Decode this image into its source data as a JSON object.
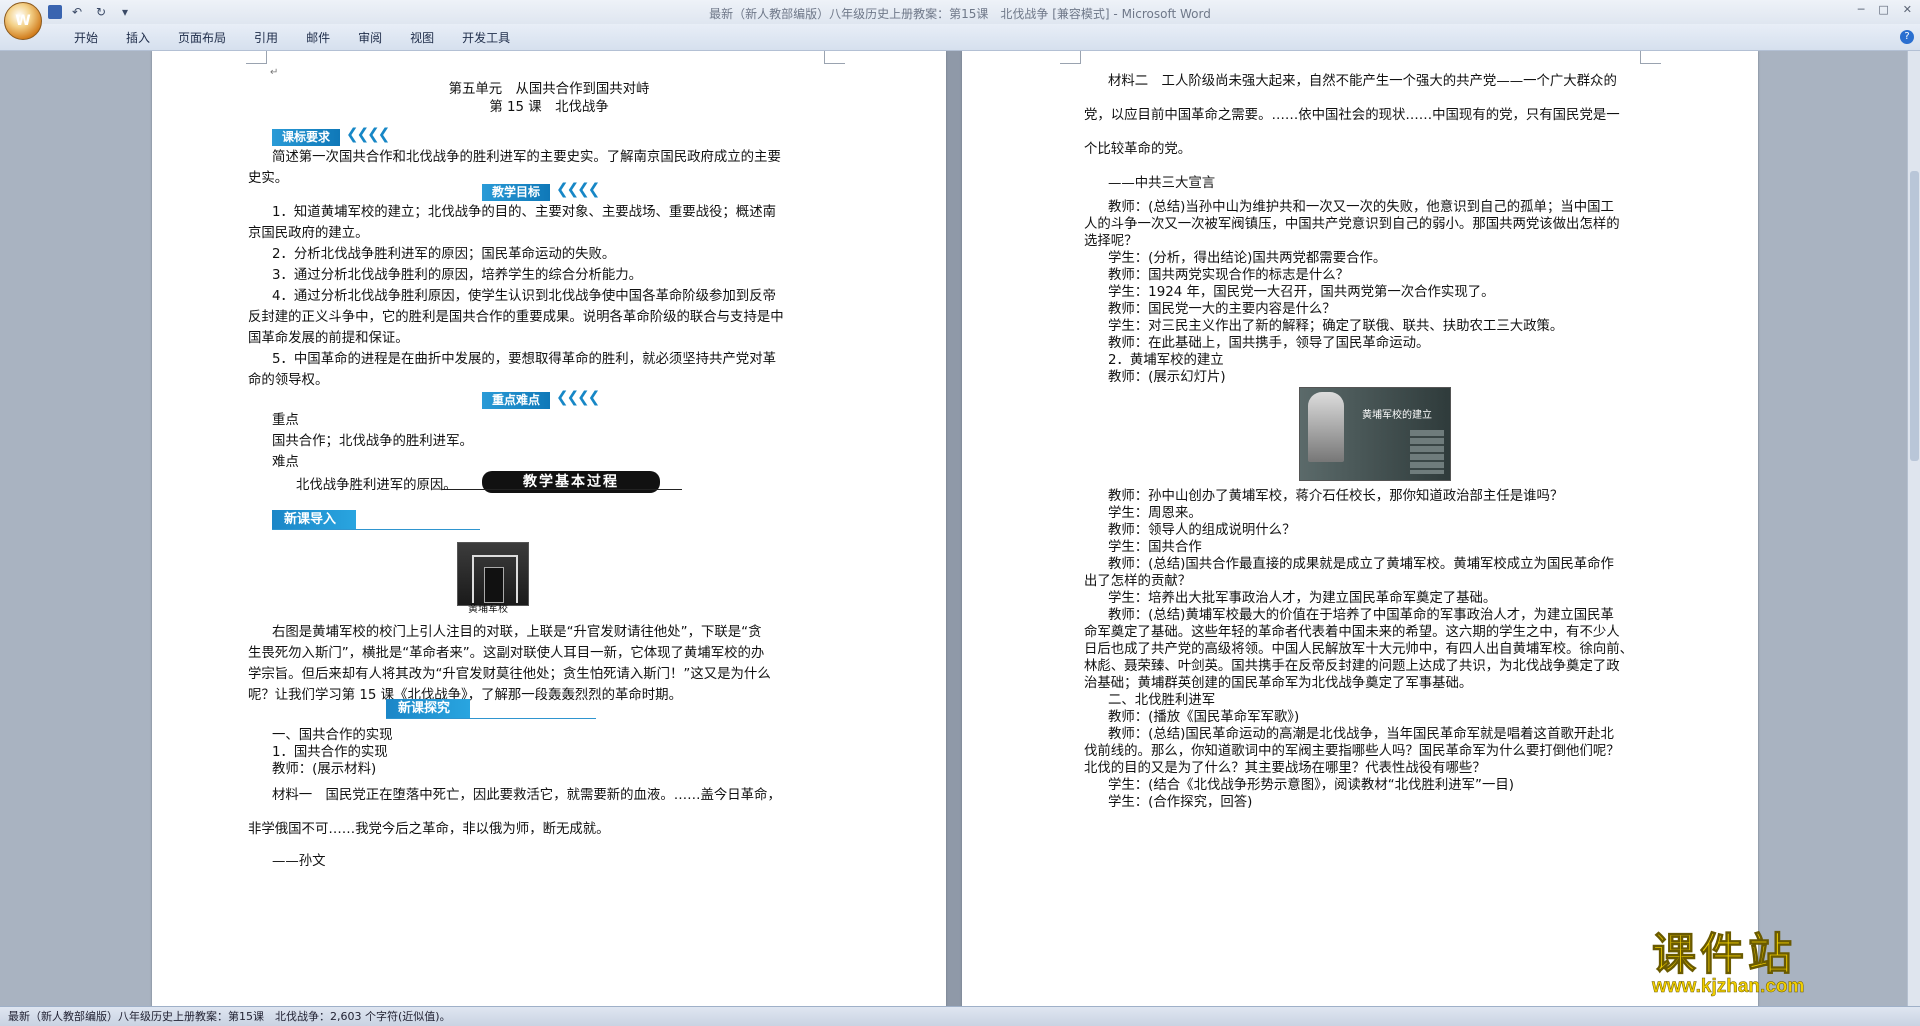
{
  "window": {
    "title": "最新（新人教部编版）八年级历史上册教案：第15课　北伐战争 [兼容模式] - Microsoft Word",
    "controls": [
      "─",
      "□",
      "✕"
    ]
  },
  "quick_access": {
    "save_icon": "save-icon",
    "undo": "↶",
    "redo": "↻",
    "more": "▾"
  },
  "ribbon": {
    "tabs": [
      "开始",
      "插入",
      "页面布局",
      "引用",
      "邮件",
      "审阅",
      "视图",
      "开发工具"
    ],
    "help": "?"
  },
  "left_page": {
    "unit_title": "第五单元　从国共合作到国共对峙",
    "lesson_title": "第 15 课　北伐战争",
    "banner_kebiao": "课标要求",
    "kebiao_text_1": "简述第一次国共合作和北伐战争的胜利进军的主要史实。了解南京国民政府成立的主要",
    "kebiao_text_2": "史实。",
    "banner_mubiao": "教学目标",
    "goal_1a": "1．知道黄埔军校的建立；北伐战争的目的、主要对象、主要战场、重要战役；概述南",
    "goal_1b": "京国民政府的建立。",
    "goal_2": "2．分析北伐战争胜利进军的原因；国民革命运动的失败。",
    "goal_3": "3．通过分析北伐战争胜利的原因，培养学生的综合分析能力。",
    "goal_4a": "4．通过分析北伐战争胜利原因，使学生认识到北伐战争使中国各革命阶级参加到反帝",
    "goal_4b": "反封建的正义斗争中，它的胜利是国共合作的重要成果。说明各革命阶级的联合与支持是中",
    "goal_4c": "国革命发展的前提和保证。",
    "goal_5a": "5．中国革命的进程是在曲折中发展的，要想取得革命的胜利，就必须坚持共产党对革",
    "goal_5b": "命的领导权。",
    "banner_zhongdian": "重点难点",
    "zhongdian_label": "重点",
    "zhongdian_text": "国共合作；北伐战争的胜利进军。",
    "nandian_label": "难点",
    "nandian_text": "北伐战争胜利进军的原因。",
    "process_banner": "教学基本过程",
    "banner_daoru": "新课导入",
    "photo_caption": "黄埔军校",
    "intro_1": "右图是黄埔军校的校门上引人注目的对联，上联是“升官发财请往他处”，下联是“贪",
    "intro_2": "生畏死勿入斯门”，横批是“革命者来”。这副对联使人耳目一新，它体现了黄埔军校的办",
    "intro_3": "学宗旨。但后来却有人将其改为“升官发财莫往他处；贪生怕死请入斯门！”这又是为什么",
    "intro_4": "呢？让我们学习第 15 课《北伐战争》，了解那一段轰轰烈烈的革命时期。",
    "banner_tanjiu": "新课探究",
    "section_1": "一、国共合作的实现",
    "section_1_1": "1．国共合作的实现",
    "teacher_show": "教师：(展示材料)",
    "material_1a": "材料一　国民党正在堕落中死亡，因此要救活它，就需要新的血液。……盖今日革命，",
    "material_1b": "非学俄国不可……我党今后之革命，非以俄为师，断无成就。",
    "material_1c": "——孙文"
  },
  "right_page": {
    "material_2a": "材料二　工人阶级尚未强大起来，自然不能产生一个强大的共产党——一个广大群众的",
    "material_2b": "党，以应目前中国革命之需要。……依中国社会的现状……中国现有的党，只有国民党是一",
    "material_2c": "个比较革命的党。",
    "material_2d": "——中共三大宣言",
    "l1": "教师：(总结)当孙中山为维护共和一次又一次的失败，他意识到自己的孤单；当中国工",
    "l2": "人的斗争一次又一次被军阀镇压，中国共产党意识到自己的弱小。那国共两党该做出怎样的",
    "l3": "选择呢？",
    "l4": "学生：(分析，得出结论)国共两党都需要合作。",
    "l5": "教师：国共两党实现合作的标志是什么？",
    "l6": "学生：1924 年，国民党一大召开，国共两党第一次合作实现了。",
    "l7": "教师：国民党一大的主要内容是什么？",
    "l8": "学生：对三民主义作出了新的解释；确定了联俄、联共、扶助农工三大政策。",
    "l9": "教师：在此基础上，国共携手，领导了国民革命运动。",
    "l10": "2．黄埔军校的建立",
    "l11": "教师：(展示幻灯片)",
    "slide_title": "黄埔军校的建立",
    "l12": "教师：孙中山创办了黄埔军校，蒋介石任校长，那你知道政治部主任是谁吗？",
    "l13": "学生：周恩来。",
    "l14": "教师：领导人的组成说明什么？",
    "l15": "学生：国共合作",
    "l16": "教师：(总结)国共合作最直接的成果就是成立了黄埔军校。黄埔军校成立为国民革命作",
    "l17": "出了怎样的贡献？",
    "l18": "学生：培养出大批军事政治人才，为建立国民革命军奠定了基础。",
    "l19": "教师：(总结)黄埔军校最大的价值在于培养了中国革命的军事政治人才，为建立国民革",
    "l20": "命军奠定了基础。这些年轻的革命者代表着中国未来的希望。这六期的学生之中，有不少人",
    "l21": "日后也成了共产党的高级将领。中国人民解放军十大元帅中，有四人出自黄埔军校。徐向前、",
    "l22": "林彪、聂荣臻、叶剑英。国共携手在反帝反封建的问题上达成了共识，为北伐战争奠定了政",
    "l23": "治基础；黄埔群英创建的国民革命军为北伐战争奠定了军事基础。",
    "l24": "二、北伐胜利进军",
    "l25": "教师：(播放《国民革命军军歌》)",
    "l26": "教师：(总结)国民革命运动的高潮是北伐战争，当年国民革命军就是唱着这首歌开赴北",
    "l27": "伐前线的。那么，你知道歌词中的军阀主要指哪些人吗？国民革命军为什么要打倒他们呢？",
    "l28": "北伐的目的又是为了什么？其主要战场在哪里？代表性战役有哪些？",
    "l29": "学生：(结合《北伐战争形势示意图》，阅读教材“北伐胜利进军”一目)",
    "l30": "学生：(合作探究，回答)"
  },
  "status_bar": {
    "text": "最新（新人教部编版）八年级历史上册教案：第15课　北伐战争：2,603 个字符(近似值)。"
  },
  "watermark": {
    "line1": "课件站",
    "line2": "www.kjzhan.com"
  },
  "colors": {
    "banner_blue": "#1787c6",
    "watermark_yellow": "#f3d000"
  }
}
